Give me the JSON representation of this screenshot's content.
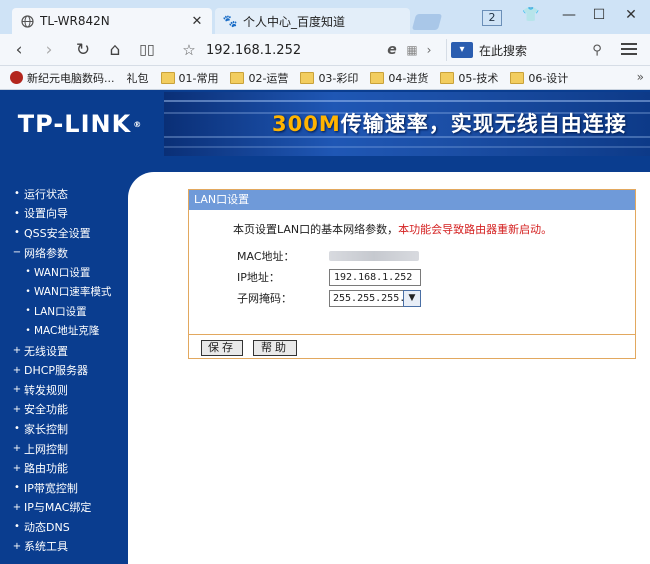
{
  "browser": {
    "tabs": [
      {
        "title": "TL-WR842N",
        "active": true
      },
      {
        "title": "个人中心_百度知道",
        "active": false
      }
    ],
    "tab_count": "2",
    "address": "192.168.1.252",
    "search_placeholder": "在此搜索",
    "bookmarks": [
      {
        "label": "新纪元电脑数码...",
        "type": "site"
      },
      {
        "label": "礼包",
        "type": "text"
      },
      {
        "label": "01-常用",
        "type": "folder"
      },
      {
        "label": "02-运营",
        "type": "folder"
      },
      {
        "label": "03-彩印",
        "type": "folder"
      },
      {
        "label": "04-进货",
        "type": "folder"
      },
      {
        "label": "05-技术",
        "type": "folder"
      },
      {
        "label": "06-设计",
        "type": "folder"
      }
    ],
    "more": "»"
  },
  "router": {
    "logo": "TP-LINK",
    "banner_highlight": "300M",
    "banner_text": "传输速率，实现无线自由连接",
    "menu": [
      {
        "label": "运行状态",
        "bullet": "•",
        "sub": false
      },
      {
        "label": "设置向导",
        "bullet": "•",
        "sub": false
      },
      {
        "label": "QSS安全设置",
        "bullet": "•",
        "sub": false
      },
      {
        "label": "网络参数",
        "bullet": "−",
        "sub": false
      },
      {
        "label": "WAN口设置",
        "bullet": "•",
        "sub": true
      },
      {
        "label": "WAN口速率模式",
        "bullet": "•",
        "sub": true
      },
      {
        "label": "LAN口设置",
        "bullet": "•",
        "sub": true
      },
      {
        "label": "MAC地址克隆",
        "bullet": "•",
        "sub": true
      },
      {
        "label": "无线设置",
        "bullet": "+",
        "sub": false
      },
      {
        "label": "DHCP服务器",
        "bullet": "+",
        "sub": false
      },
      {
        "label": "转发规则",
        "bullet": "+",
        "sub": false
      },
      {
        "label": "安全功能",
        "bullet": "+",
        "sub": false
      },
      {
        "label": "家长控制",
        "bullet": "•",
        "sub": false
      },
      {
        "label": "上网控制",
        "bullet": "+",
        "sub": false
      },
      {
        "label": "路由功能",
        "bullet": "+",
        "sub": false
      },
      {
        "label": "IP带宽控制",
        "bullet": "•",
        "sub": false
      },
      {
        "label": "IP与MAC绑定",
        "bullet": "+",
        "sub": false
      },
      {
        "label": "动态DNS",
        "bullet": "•",
        "sub": false
      },
      {
        "label": "系统工具",
        "bullet": "+",
        "sub": false
      }
    ],
    "panel": {
      "title": "LAN口设置",
      "desc": "本页设置LAN口的基本网络参数，",
      "warning": "本功能会导致路由器重新启动。",
      "mac_label": "MAC地址：",
      "ip_label": "IP地址：",
      "ip_value": "192.168.1.252",
      "mask_label": "子网掩码：",
      "mask_value": "255.255.255.0",
      "save": "保存",
      "help": "帮助"
    }
  }
}
